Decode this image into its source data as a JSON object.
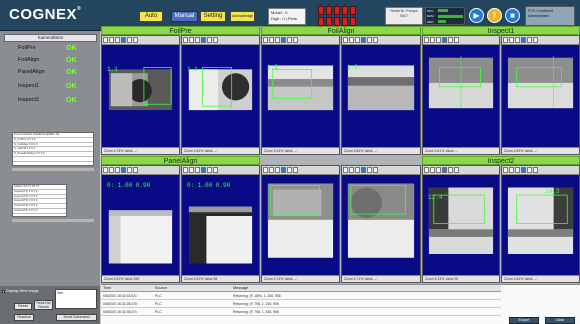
{
  "topbar": {
    "logo": "COGNEX",
    "logo_mark": "®",
    "auto": "Auto",
    "manual": "Manual",
    "setting": "Setting",
    "acknowledge": "Acknowledge",
    "model_label": "Model : 0",
    "model_sub": "Digit : 0 | Ferts",
    "serial_text": "Serial Nr. Pumpe",
    "serial_value": "0017",
    "bar_labels": [
      "CPU",
      "RAM",
      "HDD"
    ],
    "login_line1": "PCS Combined",
    "login_line2": "Administrator"
  },
  "left": {
    "kamera_button": "Kameralisten",
    "status": [
      {
        "name": "FoilPre",
        "value": "OK"
      },
      {
        "name": "FoilAlign",
        "value": "OK"
      },
      {
        "name": "PanelAlign",
        "value": "OK"
      },
      {
        "name": "Inspect1",
        "value": "OK"
      },
      {
        "name": "Inspect2",
        "value": "OK"
      }
    ],
    "table1_rows": [
      "Device   Detail1  Detail2  DetailMax  Tot",
      "S_FoilPre   0   0   0   0",
      "S_FoilAlign   0   0   0   0",
      "S_CE/FR   0   0   0   0",
      "S_PanelFoilAlign   0   0   0   0",
      "  ",
      "  "
    ],
    "table2_rows": [
      "Station  S1  T1  S2  T2",
      "Inspect(T1)  0  0  0  0",
      "Inspect(T2)  0  0  0  0",
      "Inspect(T3)  0  0  0  0",
      "Inspect(T4)  0  0  0  0",
      "Inspect(T5)  0  0  0  0"
    ],
    "display_chk": "Display New Image",
    "input_text": "Sav",
    "reset_btn": "Reset",
    "reset_all_btn": "Reset All Result",
    "readout_btn": "Readout",
    "send_cmd_btn": "Send Command"
  },
  "cameras": [
    {
      "name": "FoilPre"
    },
    {
      "name": "FoilAlign"
    },
    {
      "name": "Inspect1"
    },
    {
      "name": "PanelAlign"
    },
    {
      "name": "Inspect2"
    }
  ],
  "cells": [
    {
      "zoom": "Zoom 4.76%",
      "val": "Value ---"
    },
    {
      "zoom": "Zoom 4.54%",
      "val": "Value ---"
    },
    {
      "zoom": "Zoom 5.34%",
      "val": "Value ---"
    },
    {
      "zoom": "Zoom 5.84%",
      "val": "Value ---"
    },
    {
      "zoom": "Zoom 4.61%",
      "val": "Value ---"
    },
    {
      "zoom": "Zoom 4.55%",
      "val": "Value ---"
    },
    {
      "zoom": "Zoom 5.90%",
      "val": "Value 255"
    },
    {
      "zoom": "Zoom 5.90%",
      "val": "Value 58"
    },
    {
      "zoom": "Zoom 5.76%",
      "val": "Value ---"
    },
    {
      "zoom": "Zoom 5.71%",
      "val": "Value ---"
    },
    {
      "zoom": "Zoom 5.13%",
      "val": "Value 35"
    },
    {
      "zoom": "Zoom 4.84%",
      "val": "Value ---"
    }
  ],
  "overlays": {
    "foilpre1": "1.1",
    "foilpre2": "1.1",
    "foilalign1": "1.8",
    "foilalign2": "1.0",
    "panel1": "0: 1.00  0.90",
    "panel2": "0: 1.00  0.90",
    "insp_a": "12.4",
    "insp_b": "10.3"
  },
  "messages": {
    "headers": {
      "time": "Time",
      "source": "Source",
      "message": "Message"
    },
    "rows": [
      {
        "time": "5/8/2020 16:32:18:021",
        "source": "PLC",
        "msg": "Returning: (F, 1894, 1, 250, 958"
      },
      {
        "time": "5/8/2020 16:32:28:478",
        "source": "PLC",
        "msg": "Returning: (F, 798, 1, 230, 958"
      },
      {
        "time": "5/8/2020 16:32:35:471",
        "source": "PLC",
        "msg": "Returning: (F, 798, 1, 338, 958"
      }
    ],
    "export": "Export",
    "clear": "Clear"
  }
}
